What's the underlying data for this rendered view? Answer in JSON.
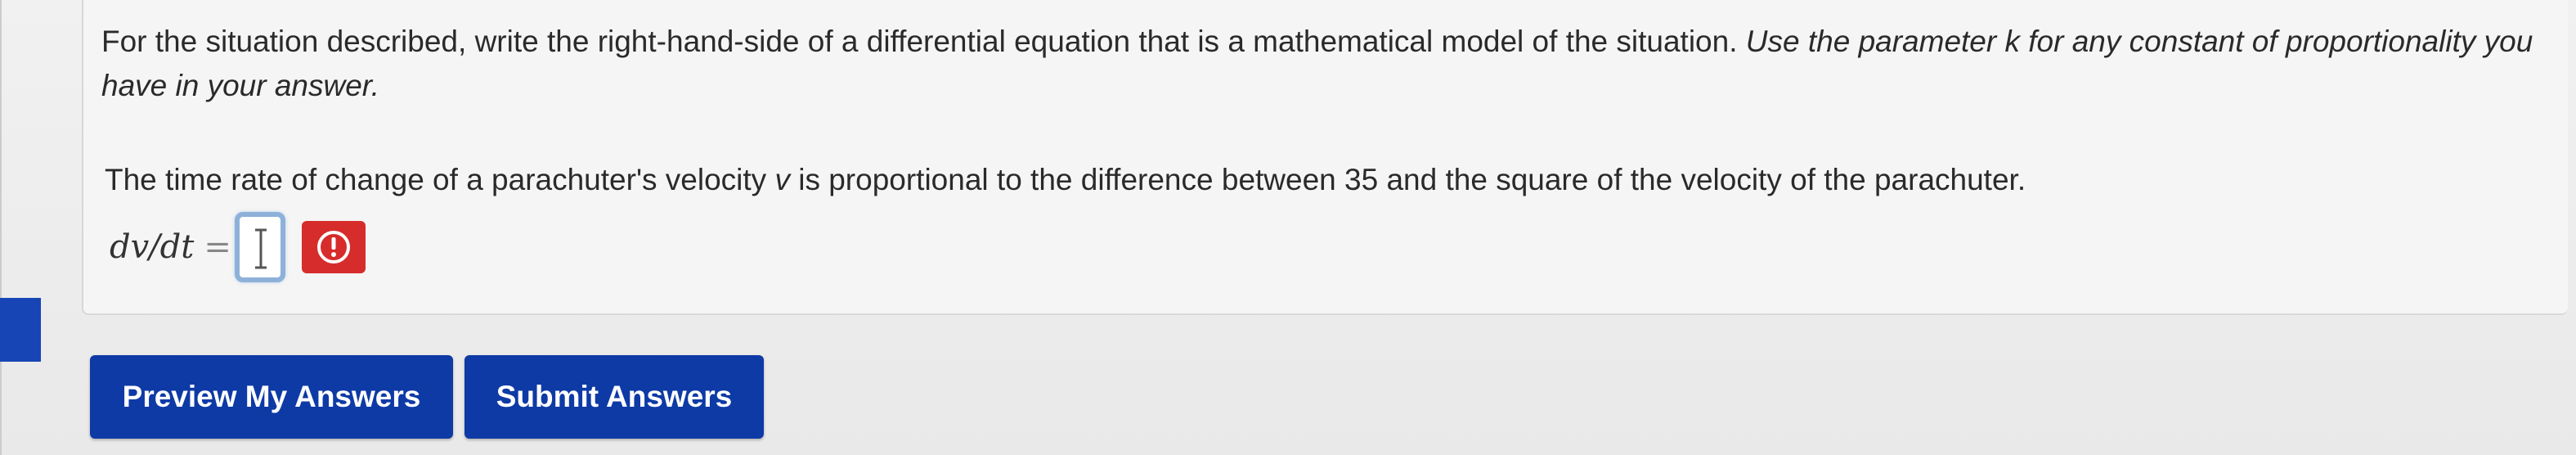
{
  "instructions": {
    "plain": "For the situation described, write the right-hand-side of a differential equation that is a mathematical model of the situation. ",
    "italic": "Use the parameter k for any constant of proportionality you have in your answer."
  },
  "question": {
    "before_var": "The time rate of change of a parachuter's velocity ",
    "var": "v",
    "after_var": " is proportional to the difference between 35 and the square of the velocity of the parachuter."
  },
  "equation": {
    "lhs": "dv/dt",
    "equals": "=",
    "answer_value": ""
  },
  "icons": {
    "error": "exclamation-circle-icon",
    "cursor": "text-cursor-icon"
  },
  "buttons": {
    "preview_label": "Preview My Answers",
    "submit_label": "Submit Answers"
  },
  "colors": {
    "button_bg": "#0e3aa6",
    "error_badge": "#d62c2c",
    "input_focus_border": "#8db1d9",
    "left_tab": "#1745b5"
  }
}
